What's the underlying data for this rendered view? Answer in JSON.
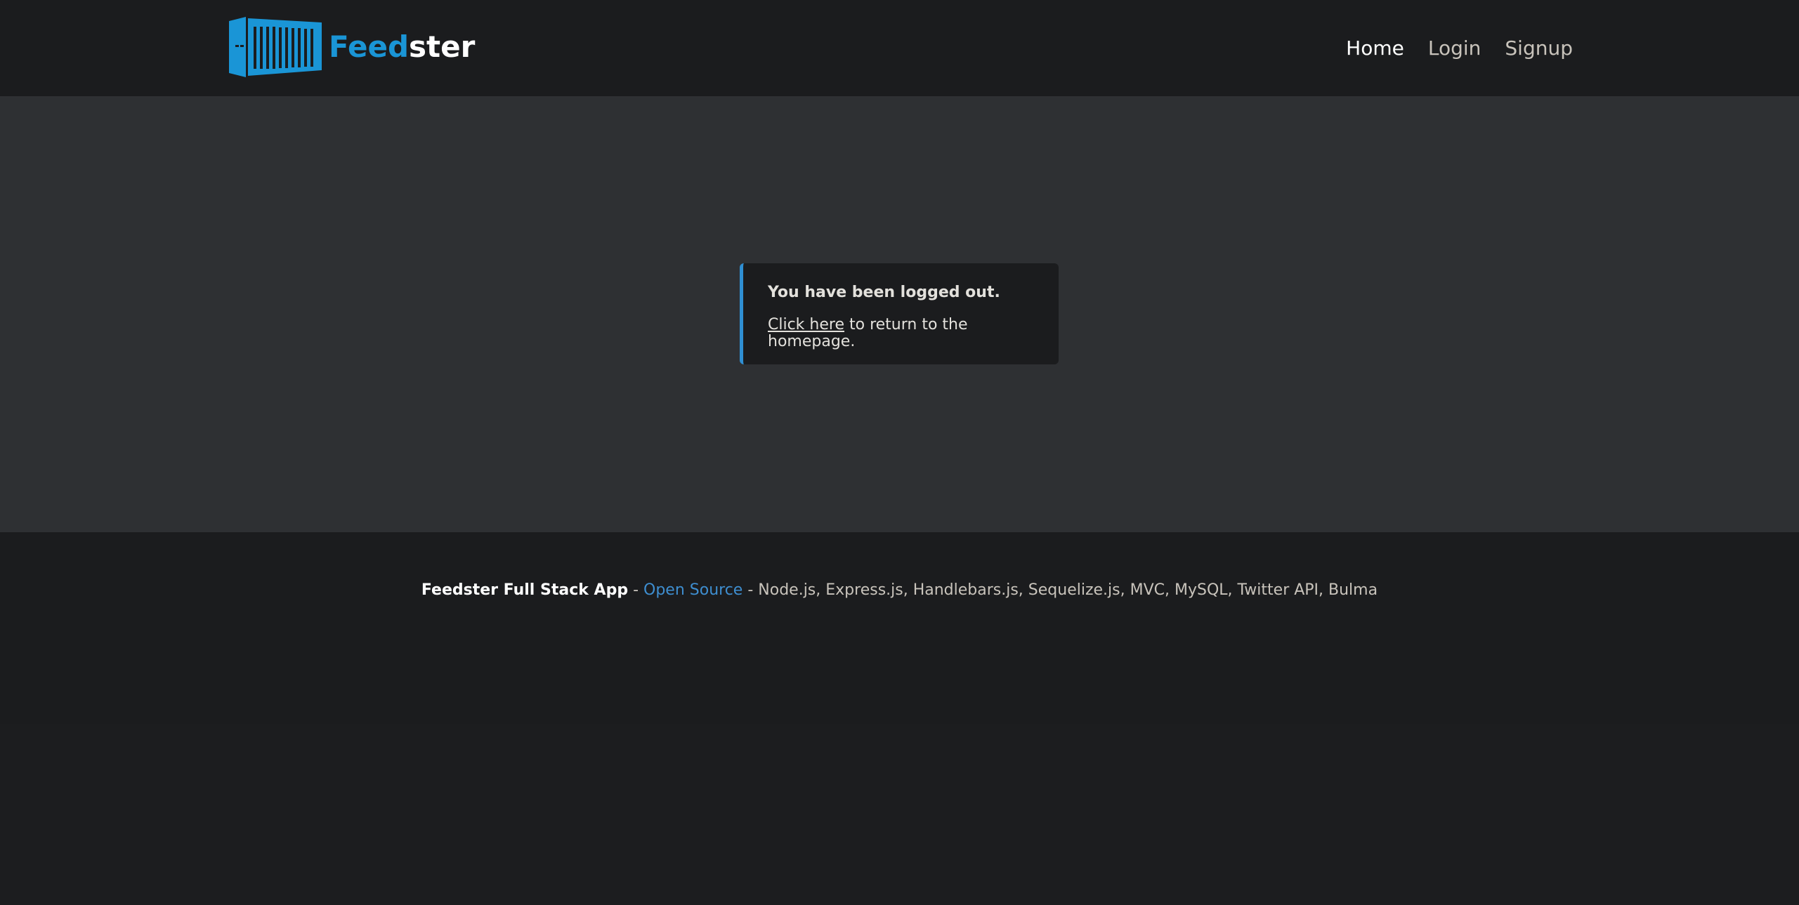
{
  "header": {
    "brand": {
      "logo": "shipping-container-icon",
      "part1": "Feed",
      "part2": "ster"
    },
    "nav": [
      {
        "label": "Home",
        "active": true
      },
      {
        "label": "Login",
        "active": false
      },
      {
        "label": "Signup",
        "active": false
      }
    ]
  },
  "notice": {
    "title": "You have been logged out.",
    "link_text": "Click here",
    "body_rest": " to return to the homepage."
  },
  "footer": {
    "app_name": "Feedster Full Stack App",
    "sep1": " - ",
    "link_text": "Open Source",
    "sep2": " - ",
    "stack": "Node.js, Express.js, Handlebars.js, Sequelize.js, MVC, MySQL, Twitter API, Bulma"
  },
  "colors": {
    "navbar_bg": "#1b1c1e",
    "main_bg": "#2e3033",
    "brand_blue": "#1a95d6",
    "notice_accent": "#2f8fd3",
    "link_blue": "#3e8ed0"
  }
}
